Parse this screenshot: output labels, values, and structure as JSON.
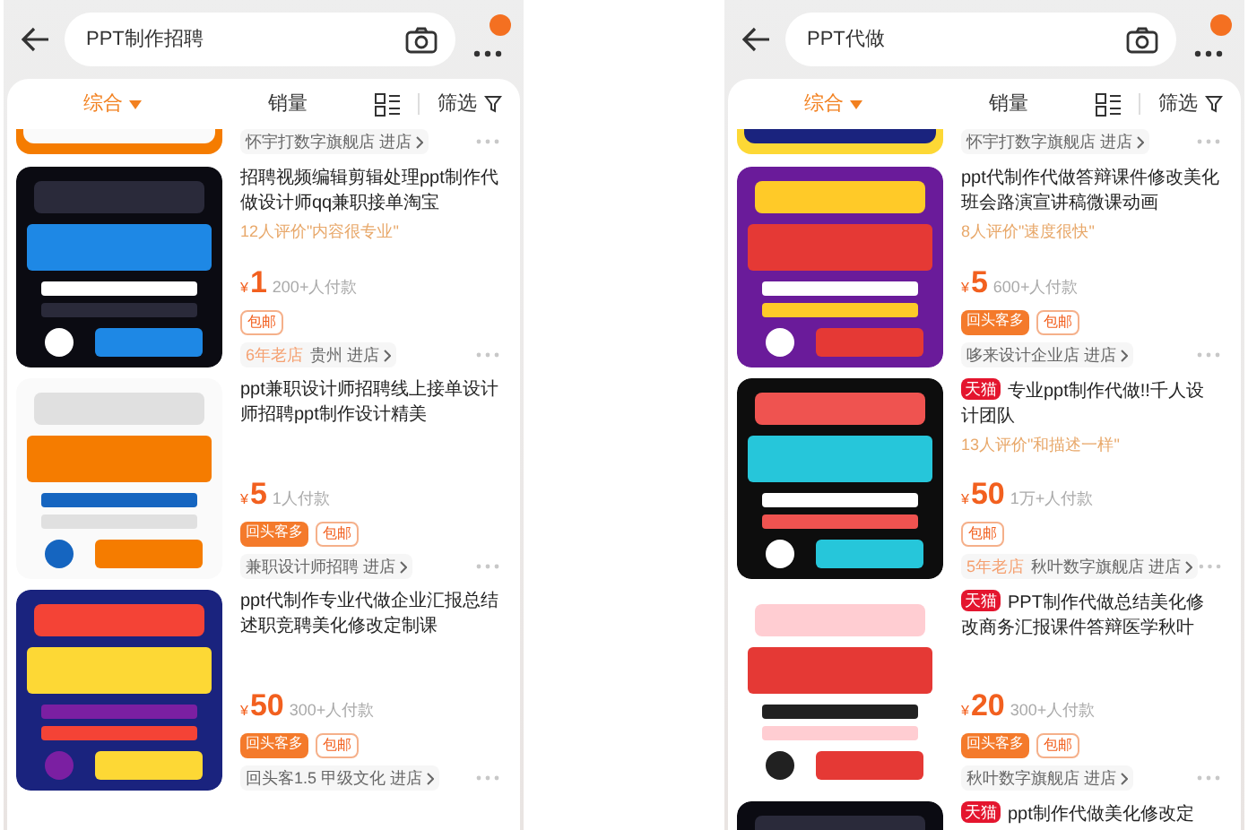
{
  "panels": [
    {
      "search": {
        "value": "PPT制作招聘"
      },
      "sort_tabs": [
        {
          "label": "综合",
          "selected": true,
          "kind": "dropdown"
        },
        {
          "label": "销量",
          "selected": false,
          "kind": "plain"
        },
        {
          "label": "筛选",
          "selected": false,
          "kind": "filter"
        }
      ],
      "partial_shop": "怀宇打数字旗舰店 进店",
      "products": [
        {
          "title": "招聘视频编辑剪辑处理ppt制作代做设计师qq兼职接单淘宝",
          "tagline": "12人评价\"内容很专业\"",
          "currency": "¥",
          "price": "1",
          "sold": "200+人付款",
          "badges": [
            {
              "label": "包邮",
              "kind": "outline"
            }
          ],
          "shop_tag": "6年老店",
          "shop": "贵州 进店"
        },
        {
          "title": "ppt兼职设计师招聘线上接单设计师招聘ppt制作设计精美",
          "currency": "¥",
          "price": "5",
          "sold": "1人付款",
          "badges": [
            {
              "label": "回头客多",
              "kind": "filled"
            },
            {
              "label": "包邮",
              "kind": "outline"
            }
          ],
          "shop": "兼职设计师招聘 进店"
        },
        {
          "title": "ppt代制作专业代做企业汇报总结述职竞聘美化修改定制课",
          "currency": "¥",
          "price": "50",
          "sold": "300+人付款",
          "badges": [
            {
              "label": "回头客多",
              "kind": "filled"
            },
            {
              "label": "包邮",
              "kind": "outline"
            }
          ],
          "shop": "回头客1.5 甲级文化 进店"
        }
      ]
    },
    {
      "search": {
        "value": "PPT代做"
      },
      "sort_tabs": [
        {
          "label": "综合",
          "selected": true,
          "kind": "dropdown"
        },
        {
          "label": "销量",
          "selected": false,
          "kind": "plain"
        },
        {
          "label": "筛选",
          "selected": false,
          "kind": "filter"
        }
      ],
      "partial_shop": "怀宇打数字旗舰店 进店",
      "products": [
        {
          "title": "ppt代制作代做答辩课件修改美化班会路演宣讲稿微课动画",
          "tagline": "8人评价\"速度很快\"",
          "currency": "¥",
          "price": "5",
          "sold": "600+人付款",
          "badges": [
            {
              "label": "回头客多",
              "kind": "filled"
            },
            {
              "label": "包邮",
              "kind": "outline"
            }
          ],
          "shop": "哆来设计企业店 进店"
        },
        {
          "store_badge": "天猫",
          "title": "专业ppt制作代做!!千人设计团队",
          "tagline": "13人评价\"和描述一样\"",
          "currency": "¥",
          "price": "50",
          "sold": "1万+人付款",
          "badges": [
            {
              "label": "包邮",
              "kind": "outline"
            }
          ],
          "shop_tag": "5年老店",
          "shop": "秋叶数字旗舰店 进店"
        },
        {
          "store_badge": "天猫",
          "title": "PPT制作代做总结美化修改商务汇报课件答辩医学秋叶",
          "currency": "¥",
          "price": "20",
          "sold": "300+人付款",
          "badges": [
            {
              "label": "回头客多",
              "kind": "filled"
            },
            {
              "label": "包邮",
              "kind": "outline"
            }
          ],
          "shop": "秋叶数字旗舰店 进店"
        },
        {
          "store_badge": "天猫",
          "title": "ppt制作代做美化修改定"
        }
      ]
    }
  ]
}
